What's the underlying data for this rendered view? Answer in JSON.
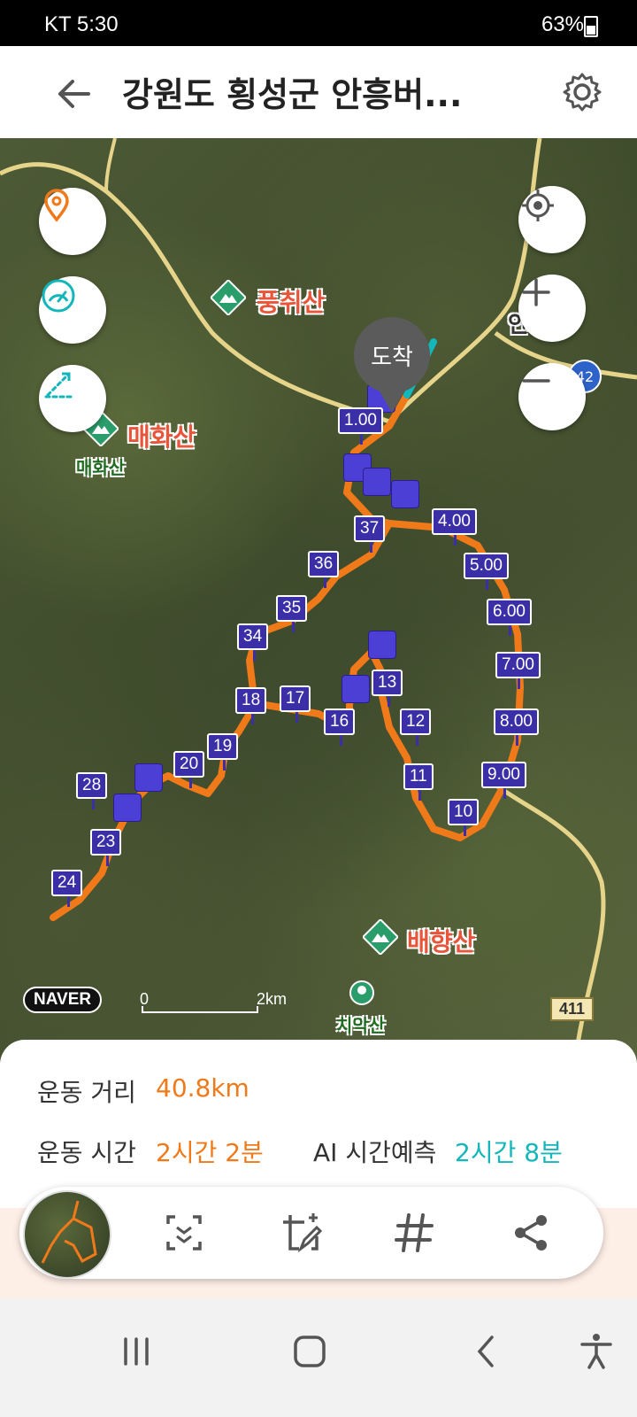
{
  "status_bar": {
    "carrier_time": "KT  5:30",
    "icons_left": [
      "notification-icon",
      "notification-icon",
      "notification-icon",
      "b-app-icon",
      "dot-icon"
    ],
    "right": "63%",
    "icons_right": [
      "location-icon",
      "wifi-icon",
      "hd-icon",
      "signal-icon",
      "battery-icon"
    ]
  },
  "header": {
    "title": "강원도 횡성군 안흥버...",
    "back_icon": "arrow-left-icon",
    "settings_icon": "gear-icon"
  },
  "map": {
    "destination_label": "도착",
    "places": [
      {
        "name": "풍취산"
      },
      {
        "name": "매화산",
        "sub": "매화산"
      },
      {
        "name": "배향산"
      },
      {
        "name": "치악산"
      }
    ],
    "partial_place": "안",
    "road_badge": "42",
    "route_shield": "411",
    "brand": "NAVER",
    "scale_start": "0",
    "scale_end": "2km",
    "km_markers": [
      "1.00",
      "37",
      "4.00",
      "36",
      "5.00",
      "35",
      "6.00",
      "34",
      "7.00",
      "13",
      "18",
      "17",
      "16",
      "12",
      "8.00",
      "19",
      "20",
      "11",
      "9.00",
      "28",
      "10",
      "23",
      "24"
    ],
    "controls": {
      "left": [
        "location-pin-icon",
        "speedometer-icon",
        "route-line-icon"
      ],
      "right": [
        "my-location-icon",
        "zoom-in-icon",
        "zoom-out-icon"
      ]
    },
    "colors": {
      "route": "#f07a1a",
      "marker": "#3a2fa6",
      "accent": "#13b7bb"
    }
  },
  "stats": {
    "distance_label": "운동 거리",
    "distance_value": "40.8km",
    "time_label": "운동 시간",
    "time_value": "2시간 2분",
    "ai_label": "AI 시간예측",
    "ai_value": "2시간 8분"
  },
  "toolbar": {
    "items": [
      "map-thumbnail",
      "scan-icon",
      "edit-image-icon",
      "hashtag-icon",
      "share-icon"
    ]
  },
  "navbar": {
    "items": [
      "recent-apps-icon",
      "home-icon",
      "back-icon",
      "accessibility-icon"
    ]
  }
}
